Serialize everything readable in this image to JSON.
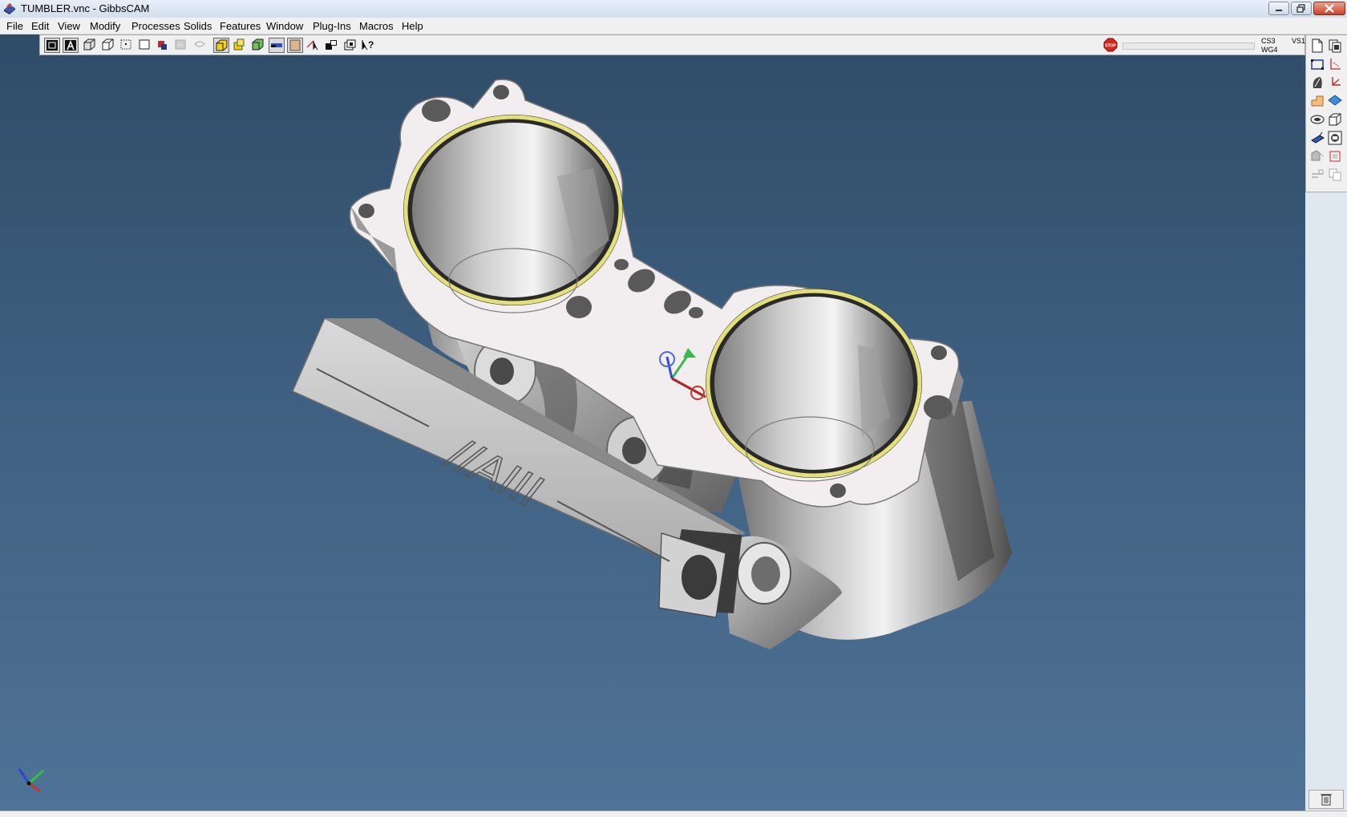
{
  "window": {
    "title": "TUMBLER.vnc - GibbsCAM"
  },
  "menu": {
    "items": [
      {
        "label": "File"
      },
      {
        "label": "Edit"
      },
      {
        "label": "View"
      },
      {
        "label": "Modify"
      },
      {
        "label": "Processes"
      },
      {
        "label": "Solids"
      },
      {
        "label": "Features"
      },
      {
        "label": "Window"
      },
      {
        "label": "Plug-Ins"
      },
      {
        "label": "Macros"
      },
      {
        "label": "Help"
      }
    ]
  },
  "toolbar": {
    "buttons": [
      "view-wireframe-icon",
      "view-annotation-icon",
      "view-solid-box-icon",
      "view-cube-icon",
      "view-point-icon",
      "view-rectangle-icon",
      "view-color-icon",
      "view-ghost-icon",
      "view-hidden-icon",
      "view-shaded-icon",
      "view-highlight-icon",
      "view-render-icon",
      "view-display-icon",
      "view-material-icon",
      "select-pointer-icon",
      "select-stack-icon",
      "select-layers-icon",
      "context-help-icon"
    ],
    "stop_icon": "stop-icon",
    "progress_fraction": 0,
    "cs_label": "CS3",
    "wg_label": "WG4",
    "vs_label": "VS1"
  },
  "palette": {
    "icons": [
      "new-document-icon",
      "document-stack-icon",
      "rectangle-icon",
      "axis-icon",
      "spline-icon",
      "coordinate-icon",
      "shape-icon",
      "plane-icon",
      "surface-icon",
      "solid-icon",
      "tool-icon",
      "tool-list-icon",
      "process-icon",
      "operation-icon",
      "disabled-process-icon",
      "disabled-copy-icon"
    ]
  },
  "viewport": {
    "model": "cylinder-block-model",
    "engraving": "//AIII",
    "triad": "axis-triad-icon",
    "background_top": "#2f4c67",
    "background_bottom": "#4f7396"
  },
  "status": {
    "trash_icon": "trash-icon"
  }
}
